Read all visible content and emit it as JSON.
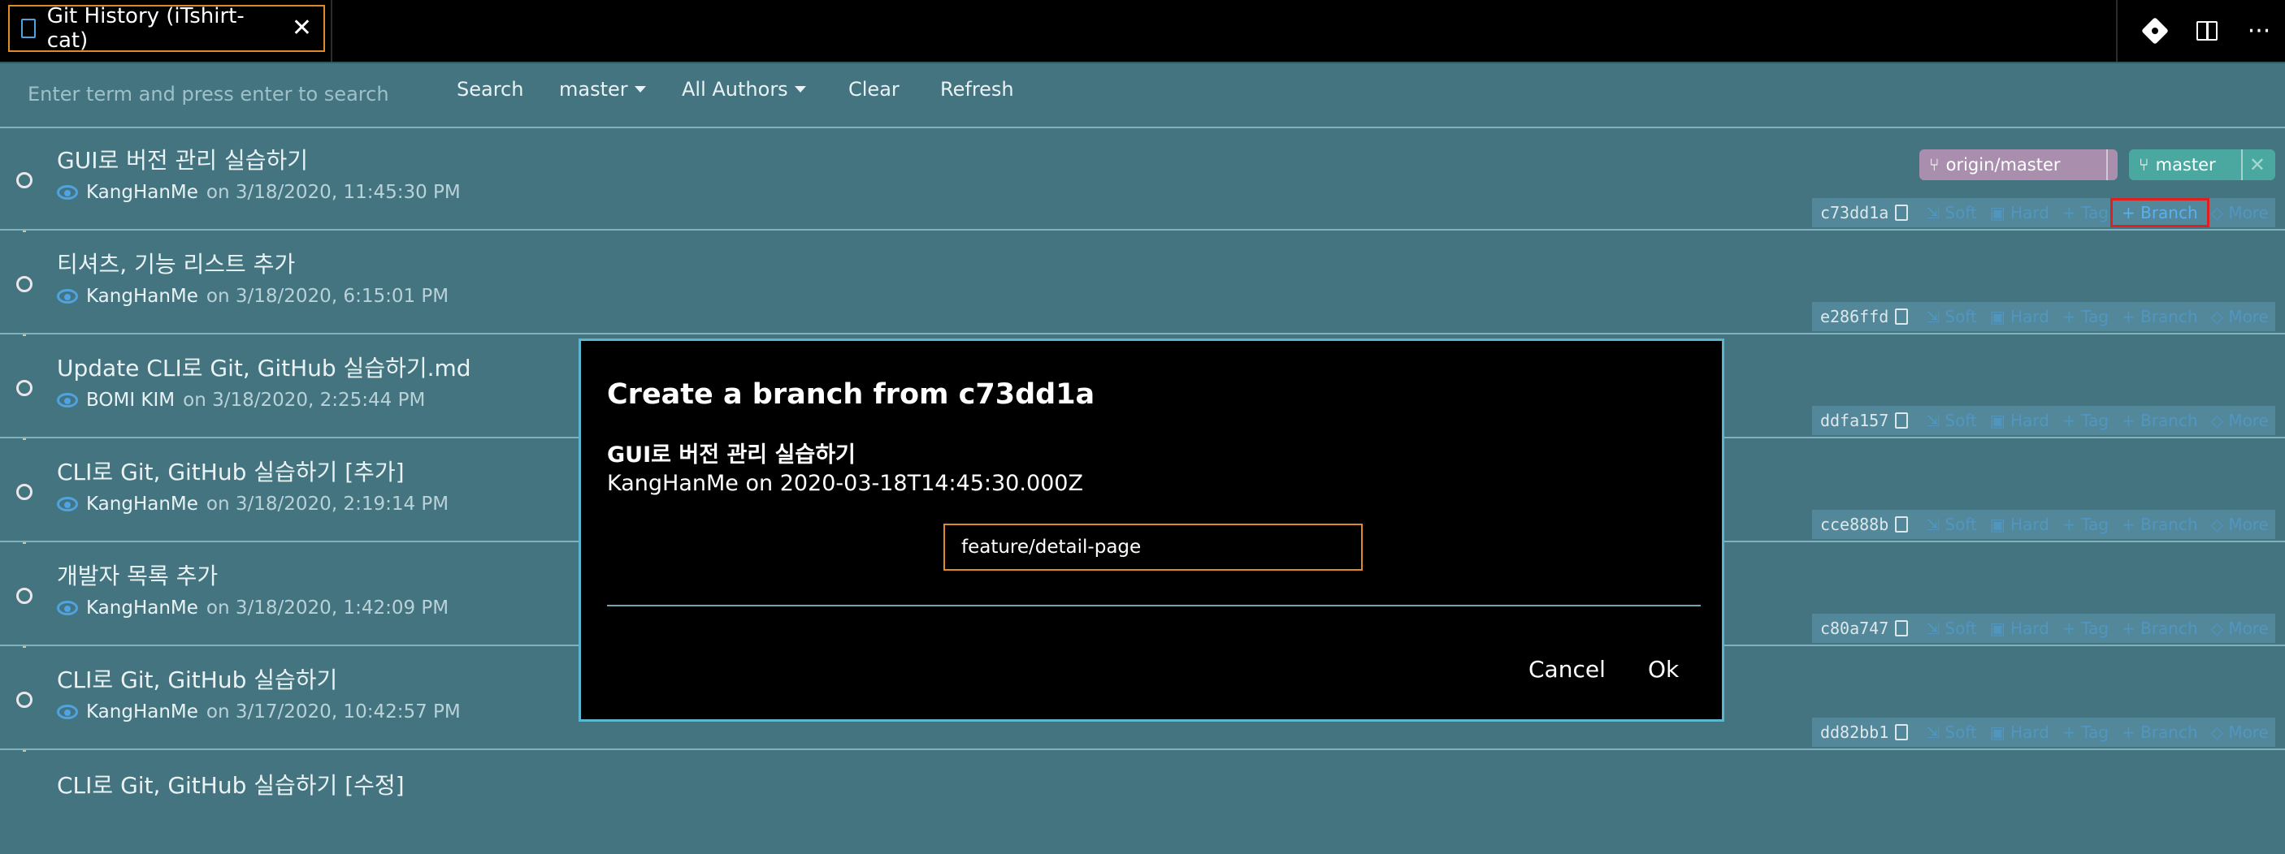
{
  "tab": {
    "title": "Git History (iTshirt-cat)"
  },
  "toolbar": {
    "search_placeholder": "Enter term and press enter to search",
    "search_label": "Search",
    "branch_label": "master",
    "authors_label": "All Authors",
    "clear_label": "Clear",
    "refresh_label": "Refresh"
  },
  "refs": {
    "origin": "origin/master",
    "local": "master"
  },
  "action_labels": {
    "soft": "Soft",
    "hard": "Hard",
    "tag": "Tag",
    "branch": "Branch",
    "more": "More"
  },
  "commits": [
    {
      "subject": "GUI로 버전 관리 실습하기",
      "author": "KangHanMe",
      "date": "on 3/18/2020, 11:45:30 PM",
      "hash": "c73dd1a"
    },
    {
      "subject": "티셔츠, 기능 리스트 추가",
      "author": "KangHanMe",
      "date": "on 3/18/2020, 6:15:01 PM",
      "hash": "e286ffd"
    },
    {
      "subject": "Update CLI로 Git, GitHub 실습하기.md",
      "author": "BOMI KIM",
      "date": "on 3/18/2020, 2:25:44 PM",
      "hash": "ddfa157"
    },
    {
      "subject": "CLI로 Git, GitHub 실습하기 [추가]",
      "author": "KangHanMe",
      "date": "on 3/18/2020, 2:19:14 PM",
      "hash": "cce888b"
    },
    {
      "subject": "개발자 목록 추가",
      "author": "KangHanMe",
      "date": "on 3/18/2020, 1:42:09 PM",
      "hash": "c80a747"
    },
    {
      "subject": "CLI로 Git, GitHub 실습하기",
      "author": "KangHanMe",
      "date": "on 3/17/2020, 10:42:57 PM",
      "hash": "dd82bb1"
    },
    {
      "subject": "CLI로 Git, GitHub 실습하기 [수정]",
      "author": "",
      "date": "",
      "hash": ""
    }
  ],
  "modal": {
    "title": "Create a branch from c73dd1a",
    "commit_subject": "GUI로 버전 관리 실습하기",
    "commit_info": "KangHanMe on 2020-03-18T14:45:30.000Z",
    "branch_name_value": "feature/detail-page",
    "cancel_label": "Cancel",
    "ok_label": "Ok"
  }
}
